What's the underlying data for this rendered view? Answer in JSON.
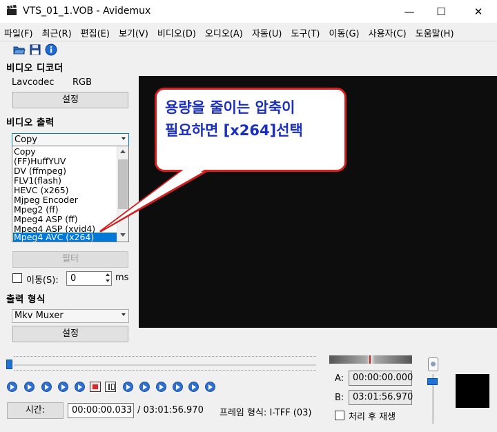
{
  "window": {
    "title": "VTS_01_1.VOB - Avidemux",
    "minimize": "—",
    "maximize": "☐",
    "close": "✕"
  },
  "menu": [
    "파일(F)",
    "최근(R)",
    "편집(E)",
    "보기(V)",
    "비디오(D)",
    "오디오(A)",
    "자동(U)",
    "도구(T)",
    "이동(G)",
    "사용자(C)",
    "도움말(H)"
  ],
  "video_decoder": {
    "title": "비디오 디코더",
    "codec": "Lavcodec",
    "colorspace": "RGB",
    "settings_label": "설정"
  },
  "video_output": {
    "title": "비디오 출력",
    "selected": "Copy",
    "options": [
      "Copy",
      "(FF)HuffYUV",
      "DV (ffmpeg)",
      "FLV1(flash)",
      "HEVC (x265)",
      "Mjpeg Encoder",
      "Mpeg2 (ff)",
      "Mpeg4 ASP (ff)",
      "Mpeg4 ASP (xvid4)",
      "Mpeg4 AVC (x264)"
    ],
    "highlighted_index": 9,
    "filter_label": "필터",
    "shift_label": "이동(S):",
    "shift_value": "0",
    "shift_unit": "ms"
  },
  "output_format": {
    "title": "출력 형식",
    "selected": "Mkv Muxer",
    "settings_label": "설정"
  },
  "callout": {
    "line1": "용량을 줄이는 압축이",
    "line2": "필요하면 [x264]선택"
  },
  "timeline": {
    "a_label": "A:",
    "a_value": "00:00:00.000",
    "b_label": "B:",
    "b_value": "03:01:56.970",
    "play_after_label": "처리 후 재생"
  },
  "status": {
    "time_label": "시간:",
    "current_time": "00:00:00.033",
    "total_time": "/ 03:01:56.970",
    "frame_type": "프레임 형식: I-TFF (03)"
  },
  "colors": {
    "accent": "#0078d7",
    "callout_border": "#d32020",
    "callout_text": "#1a2fbf"
  }
}
